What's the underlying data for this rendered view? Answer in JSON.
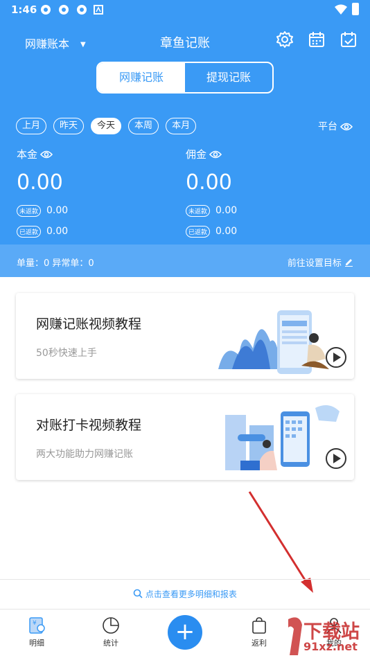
{
  "status": {
    "time": "1:46"
  },
  "header": {
    "book": "网赚账本",
    "title": "章鱼记账"
  },
  "tabs_segment": {
    "left": "网赚记账",
    "right": "提现记账"
  },
  "periods": [
    "上月",
    "昨天",
    "今天",
    "本周",
    "本月"
  ],
  "selected_period": "今天",
  "platform_label": "平台",
  "principal": {
    "label": "本金",
    "amount": "0.00",
    "unreturned_tag": "未返款",
    "unreturned": "0.00",
    "returned_tag": "已返款",
    "returned": "0.00"
  },
  "commission": {
    "label": "佣金",
    "amount": "0.00",
    "unreturned_tag": "未返款",
    "unreturned": "0.00",
    "returned_tag": "已返款",
    "returned": "0.00"
  },
  "stats": {
    "summary": "单量：0 异常单：0",
    "goal_link": "前往设置目标"
  },
  "cards": [
    {
      "title": "网赚记账视频教程",
      "subtitle": "50秒快速上手"
    },
    {
      "title": "对账打卡视频教程",
      "subtitle": "两大功能助力网赚记账"
    }
  ],
  "more_link": "点击查看更多明细和报表",
  "bottom_nav": [
    {
      "label": "明细"
    },
    {
      "label": "统计"
    },
    {
      "label": "返利"
    },
    {
      "label": "我的"
    }
  ],
  "watermark": {
    "brand": "下载站",
    "url": "91xz.net"
  },
  "colors": {
    "primary": "#3a9af5",
    "band": "#5aaaf7",
    "annotation_arrow": "#d32f2f"
  }
}
